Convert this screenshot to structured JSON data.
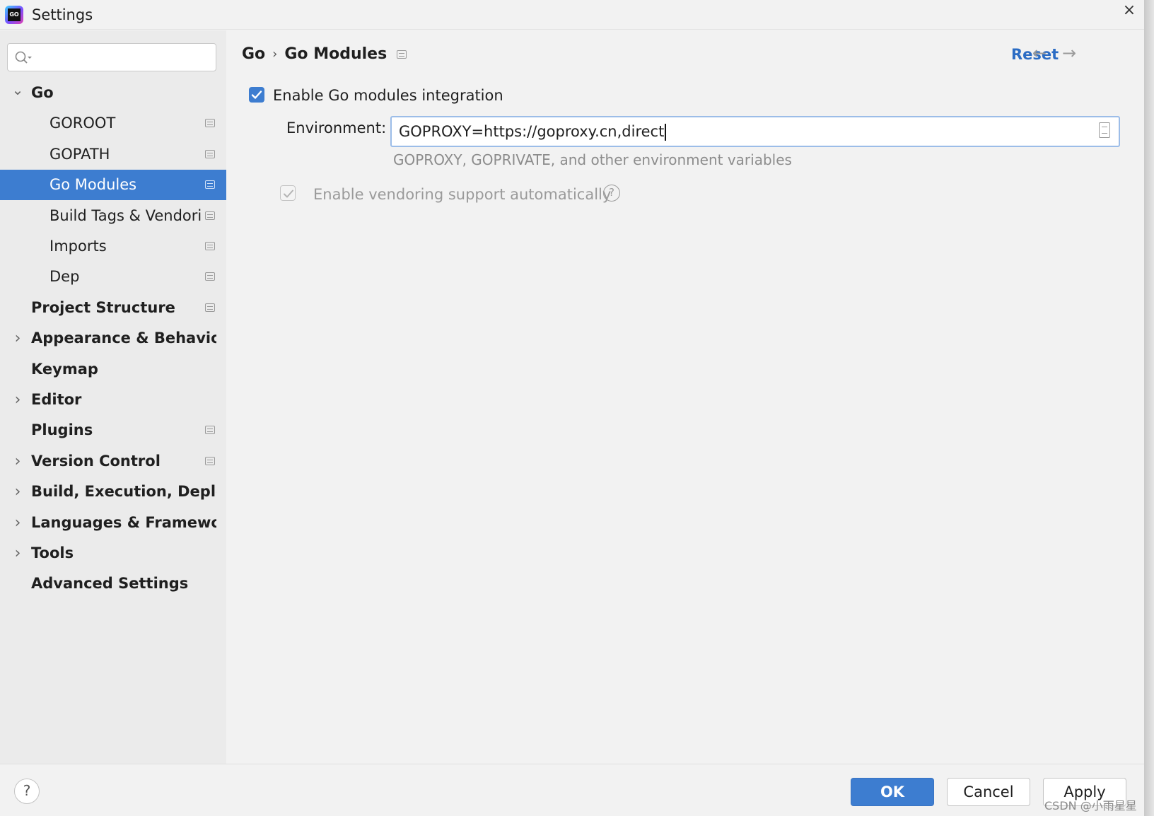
{
  "window": {
    "title": "Settings",
    "app_icon": "goland-logo",
    "app_icon_text": "GO",
    "close_glyph": "×"
  },
  "sidebar": {
    "search": {
      "placeholder": "",
      "value": ""
    },
    "items": [
      {
        "label": "Go",
        "level": 0,
        "chevron": "down",
        "project_icon": false,
        "selected": false
      },
      {
        "label": "GOROOT",
        "level": 1,
        "chevron": "",
        "project_icon": true,
        "selected": false
      },
      {
        "label": "GOPATH",
        "level": 1,
        "chevron": "",
        "project_icon": true,
        "selected": false
      },
      {
        "label": "Go Modules",
        "level": 1,
        "chevron": "",
        "project_icon": true,
        "selected": true
      },
      {
        "label": "Build Tags & Vendori",
        "level": 1,
        "chevron": "",
        "project_icon": true,
        "selected": false
      },
      {
        "label": "Imports",
        "level": 1,
        "chevron": "",
        "project_icon": true,
        "selected": false
      },
      {
        "label": "Dep",
        "level": 1,
        "chevron": "",
        "project_icon": true,
        "selected": false
      },
      {
        "label": "Project Structure",
        "level": 0,
        "chevron": "",
        "project_icon": true,
        "selected": false
      },
      {
        "label": "Appearance & Behavior",
        "level": 0,
        "chevron": "right",
        "project_icon": false,
        "selected": false
      },
      {
        "label": "Keymap",
        "level": 0,
        "chevron": "",
        "project_icon": false,
        "selected": false
      },
      {
        "label": "Editor",
        "level": 0,
        "chevron": "right",
        "project_icon": false,
        "selected": false
      },
      {
        "label": "Plugins",
        "level": 0,
        "chevron": "",
        "project_icon": true,
        "selected": false
      },
      {
        "label": "Version Control",
        "level": 0,
        "chevron": "right",
        "project_icon": true,
        "selected": false
      },
      {
        "label": "Build, Execution, Deployr",
        "level": 0,
        "chevron": "right",
        "project_icon": false,
        "selected": false
      },
      {
        "label": "Languages & Framework:",
        "level": 0,
        "chevron": "right",
        "project_icon": false,
        "selected": false
      },
      {
        "label": "Tools",
        "level": 0,
        "chevron": "right",
        "project_icon": false,
        "selected": false
      },
      {
        "label": "Advanced Settings",
        "level": 0,
        "chevron": "",
        "project_icon": false,
        "selected": false
      }
    ]
  },
  "header": {
    "breadcrumb": [
      "Go",
      "Go Modules"
    ],
    "breadcrumb_separator": "›",
    "reset_label": "Reset",
    "back_arrow": "←",
    "forward_arrow": "→"
  },
  "form": {
    "enable_modules": {
      "label": "Enable Go modules integration",
      "checked": true
    },
    "environment": {
      "label": "Environment:",
      "value": "GOPROXY=https://goproxy.cn,direct",
      "hint": "GOPROXY, GOPRIVATE, and other environment variables"
    },
    "vendoring": {
      "label": "Enable vendoring support automatically",
      "checked": true,
      "enabled": false,
      "help_glyph": "?"
    }
  },
  "footer": {
    "help_glyph": "?",
    "ok_label": "OK",
    "cancel_label": "Cancel",
    "apply_label": "Apply"
  },
  "watermark": "CSDN @小雨星星",
  "colors": {
    "accent": "#3d7dd0",
    "link": "#2b6cc4",
    "window_bg": "#f2f2f2",
    "sidebar_bg": "#ebebeb",
    "muted_text": "#8c8c8c"
  }
}
